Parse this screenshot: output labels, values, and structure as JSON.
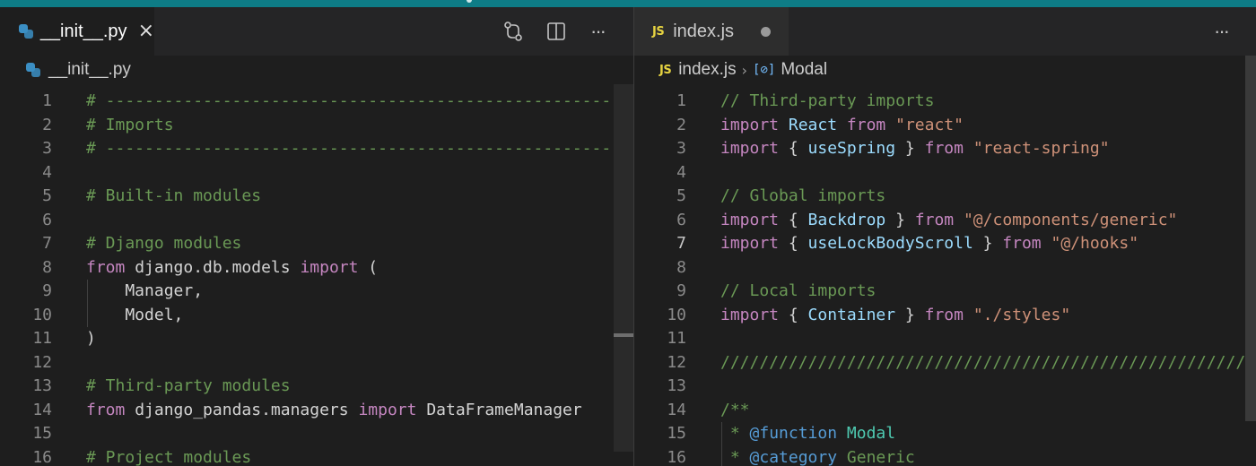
{
  "colors": {
    "titlebar_accent": "#0e7c86",
    "editor_bg": "#1e1e1e",
    "comment": "#6a9955",
    "keyword": "#c586c0",
    "string": "#ce9178",
    "identifier": "#9cdcfe",
    "jsdoc_tag": "#569cd6",
    "jsdoc_type": "#4ec9b0",
    "line_number": "#8a8a8a"
  },
  "left_pane": {
    "tab": {
      "label": "__init__.py",
      "icon": "python-icon",
      "close_icon": "close-icon",
      "close_glyph": "×"
    },
    "actions": [
      {
        "name": "open-changes-button",
        "icon": "git-compare-icon"
      },
      {
        "name": "split-editor-button",
        "icon": "split-editor-icon"
      },
      {
        "name": "more-actions-button",
        "icon": "ellipsis-icon",
        "glyph": "···"
      }
    ],
    "breadcrumb": {
      "file": "__init__.py",
      "icon": "python-icon"
    },
    "lines": [
      {
        "n": "1",
        "tokens": [
          {
            "t": "# ------------------------------------------------------",
            "c": "cm"
          }
        ]
      },
      {
        "n": "2",
        "tokens": [
          {
            "t": "# Imports",
            "c": "cm"
          }
        ]
      },
      {
        "n": "3",
        "tokens": [
          {
            "t": "# ------------------------------------------------------",
            "c": "cm"
          }
        ]
      },
      {
        "n": "4",
        "tokens": []
      },
      {
        "n": "5",
        "tokens": [
          {
            "t": "# Built-in modules",
            "c": "cm"
          }
        ]
      },
      {
        "n": "6",
        "tokens": []
      },
      {
        "n": "7",
        "tokens": [
          {
            "t": "# Django modules",
            "c": "cm"
          }
        ]
      },
      {
        "n": "8",
        "tokens": [
          {
            "t": "from",
            "c": "kw"
          },
          {
            "t": " django.db.models ",
            "c": "tx"
          },
          {
            "t": "import",
            "c": "kw"
          },
          {
            "t": " (",
            "c": "tx"
          }
        ]
      },
      {
        "n": "9",
        "tokens": [
          {
            "t": "    Manager,",
            "c": "tx"
          }
        ]
      },
      {
        "n": "10",
        "tokens": [
          {
            "t": "    Model,",
            "c": "tx"
          }
        ]
      },
      {
        "n": "11",
        "tokens": [
          {
            "t": ")",
            "c": "tx"
          }
        ]
      },
      {
        "n": "12",
        "tokens": []
      },
      {
        "n": "13",
        "tokens": [
          {
            "t": "# Third-party modules",
            "c": "cm"
          }
        ]
      },
      {
        "n": "14",
        "tokens": [
          {
            "t": "from",
            "c": "kw"
          },
          {
            "t": " django_pandas.managers ",
            "c": "tx"
          },
          {
            "t": "import",
            "c": "kw"
          },
          {
            "t": " DataFrameManager",
            "c": "tx"
          }
        ]
      },
      {
        "n": "15",
        "tokens": []
      },
      {
        "n": "16",
        "tokens": [
          {
            "t": "# Project modules",
            "c": "cm"
          }
        ]
      }
    ]
  },
  "right_pane": {
    "tab": {
      "label": "index.js",
      "icon_text": "JS",
      "dirty_indicator": "unsaved-dot-icon"
    },
    "actions": [
      {
        "name": "more-actions-button",
        "icon": "ellipsis-icon",
        "glyph": "···"
      }
    ],
    "breadcrumb": {
      "file": "index.js",
      "icon_text": "JS",
      "symbol_icon_text": "[⊘]",
      "symbol": "Modal"
    },
    "lines": [
      {
        "n": "1",
        "tokens": [
          {
            "t": "// Third-party imports",
            "c": "cm"
          }
        ]
      },
      {
        "n": "2",
        "tokens": [
          {
            "t": "import",
            "c": "kw"
          },
          {
            "t": " ",
            "c": "tx"
          },
          {
            "t": "React",
            "c": "id"
          },
          {
            "t": " ",
            "c": "tx"
          },
          {
            "t": "from",
            "c": "kw"
          },
          {
            "t": " ",
            "c": "tx"
          },
          {
            "t": "\"react\"",
            "c": "st"
          }
        ]
      },
      {
        "n": "3",
        "tokens": [
          {
            "t": "import",
            "c": "kw"
          },
          {
            "t": " { ",
            "c": "tx"
          },
          {
            "t": "useSpring",
            "c": "id"
          },
          {
            "t": " } ",
            "c": "tx"
          },
          {
            "t": "from",
            "c": "kw"
          },
          {
            "t": " ",
            "c": "tx"
          },
          {
            "t": "\"react-spring\"",
            "c": "st"
          }
        ]
      },
      {
        "n": "4",
        "tokens": []
      },
      {
        "n": "5",
        "tokens": [
          {
            "t": "// Global imports",
            "c": "cm"
          }
        ]
      },
      {
        "n": "6",
        "tokens": [
          {
            "t": "import",
            "c": "kw"
          },
          {
            "t": " { ",
            "c": "tx"
          },
          {
            "t": "Backdrop",
            "c": "id"
          },
          {
            "t": " } ",
            "c": "tx"
          },
          {
            "t": "from",
            "c": "kw"
          },
          {
            "t": " ",
            "c": "tx"
          },
          {
            "t": "\"@/components/generic\"",
            "c": "st"
          }
        ]
      },
      {
        "n": "7",
        "tokens": [
          {
            "t": "import",
            "c": "kw"
          },
          {
            "t": " { ",
            "c": "tx"
          },
          {
            "t": "useLockBodyScroll",
            "c": "id"
          },
          {
            "t": " } ",
            "c": "tx"
          },
          {
            "t": "from",
            "c": "kw"
          },
          {
            "t": " ",
            "c": "tx"
          },
          {
            "t": "\"@/hooks\"",
            "c": "st"
          }
        ]
      },
      {
        "n": "8",
        "tokens": []
      },
      {
        "n": "9",
        "tokens": [
          {
            "t": "// Local imports",
            "c": "cm"
          }
        ]
      },
      {
        "n": "10",
        "tokens": [
          {
            "t": "import",
            "c": "kw"
          },
          {
            "t": " { ",
            "c": "tx"
          },
          {
            "t": "Container",
            "c": "id"
          },
          {
            "t": " } ",
            "c": "tx"
          },
          {
            "t": "from",
            "c": "kw"
          },
          {
            "t": " ",
            "c": "tx"
          },
          {
            "t": "\"./styles\"",
            "c": "st"
          }
        ]
      },
      {
        "n": "11",
        "tokens": []
      },
      {
        "n": "12",
        "tokens": [
          {
            "t": "//////////////////////////////////////////////////////////",
            "c": "cm"
          }
        ]
      },
      {
        "n": "13",
        "tokens": []
      },
      {
        "n": "14",
        "tokens": [
          {
            "t": "/**",
            "c": "cm"
          }
        ]
      },
      {
        "n": "15",
        "tokens": [
          {
            "t": " * ",
            "c": "cm"
          },
          {
            "t": "@function",
            "c": "tg"
          },
          {
            "t": " ",
            "c": "cm"
          },
          {
            "t": "Modal",
            "c": "ty"
          }
        ]
      },
      {
        "n": "16",
        "tokens": [
          {
            "t": " * ",
            "c": "cm"
          },
          {
            "t": "@category",
            "c": "tg"
          },
          {
            "t": " Generic",
            "c": "cm"
          }
        ]
      }
    ]
  }
}
